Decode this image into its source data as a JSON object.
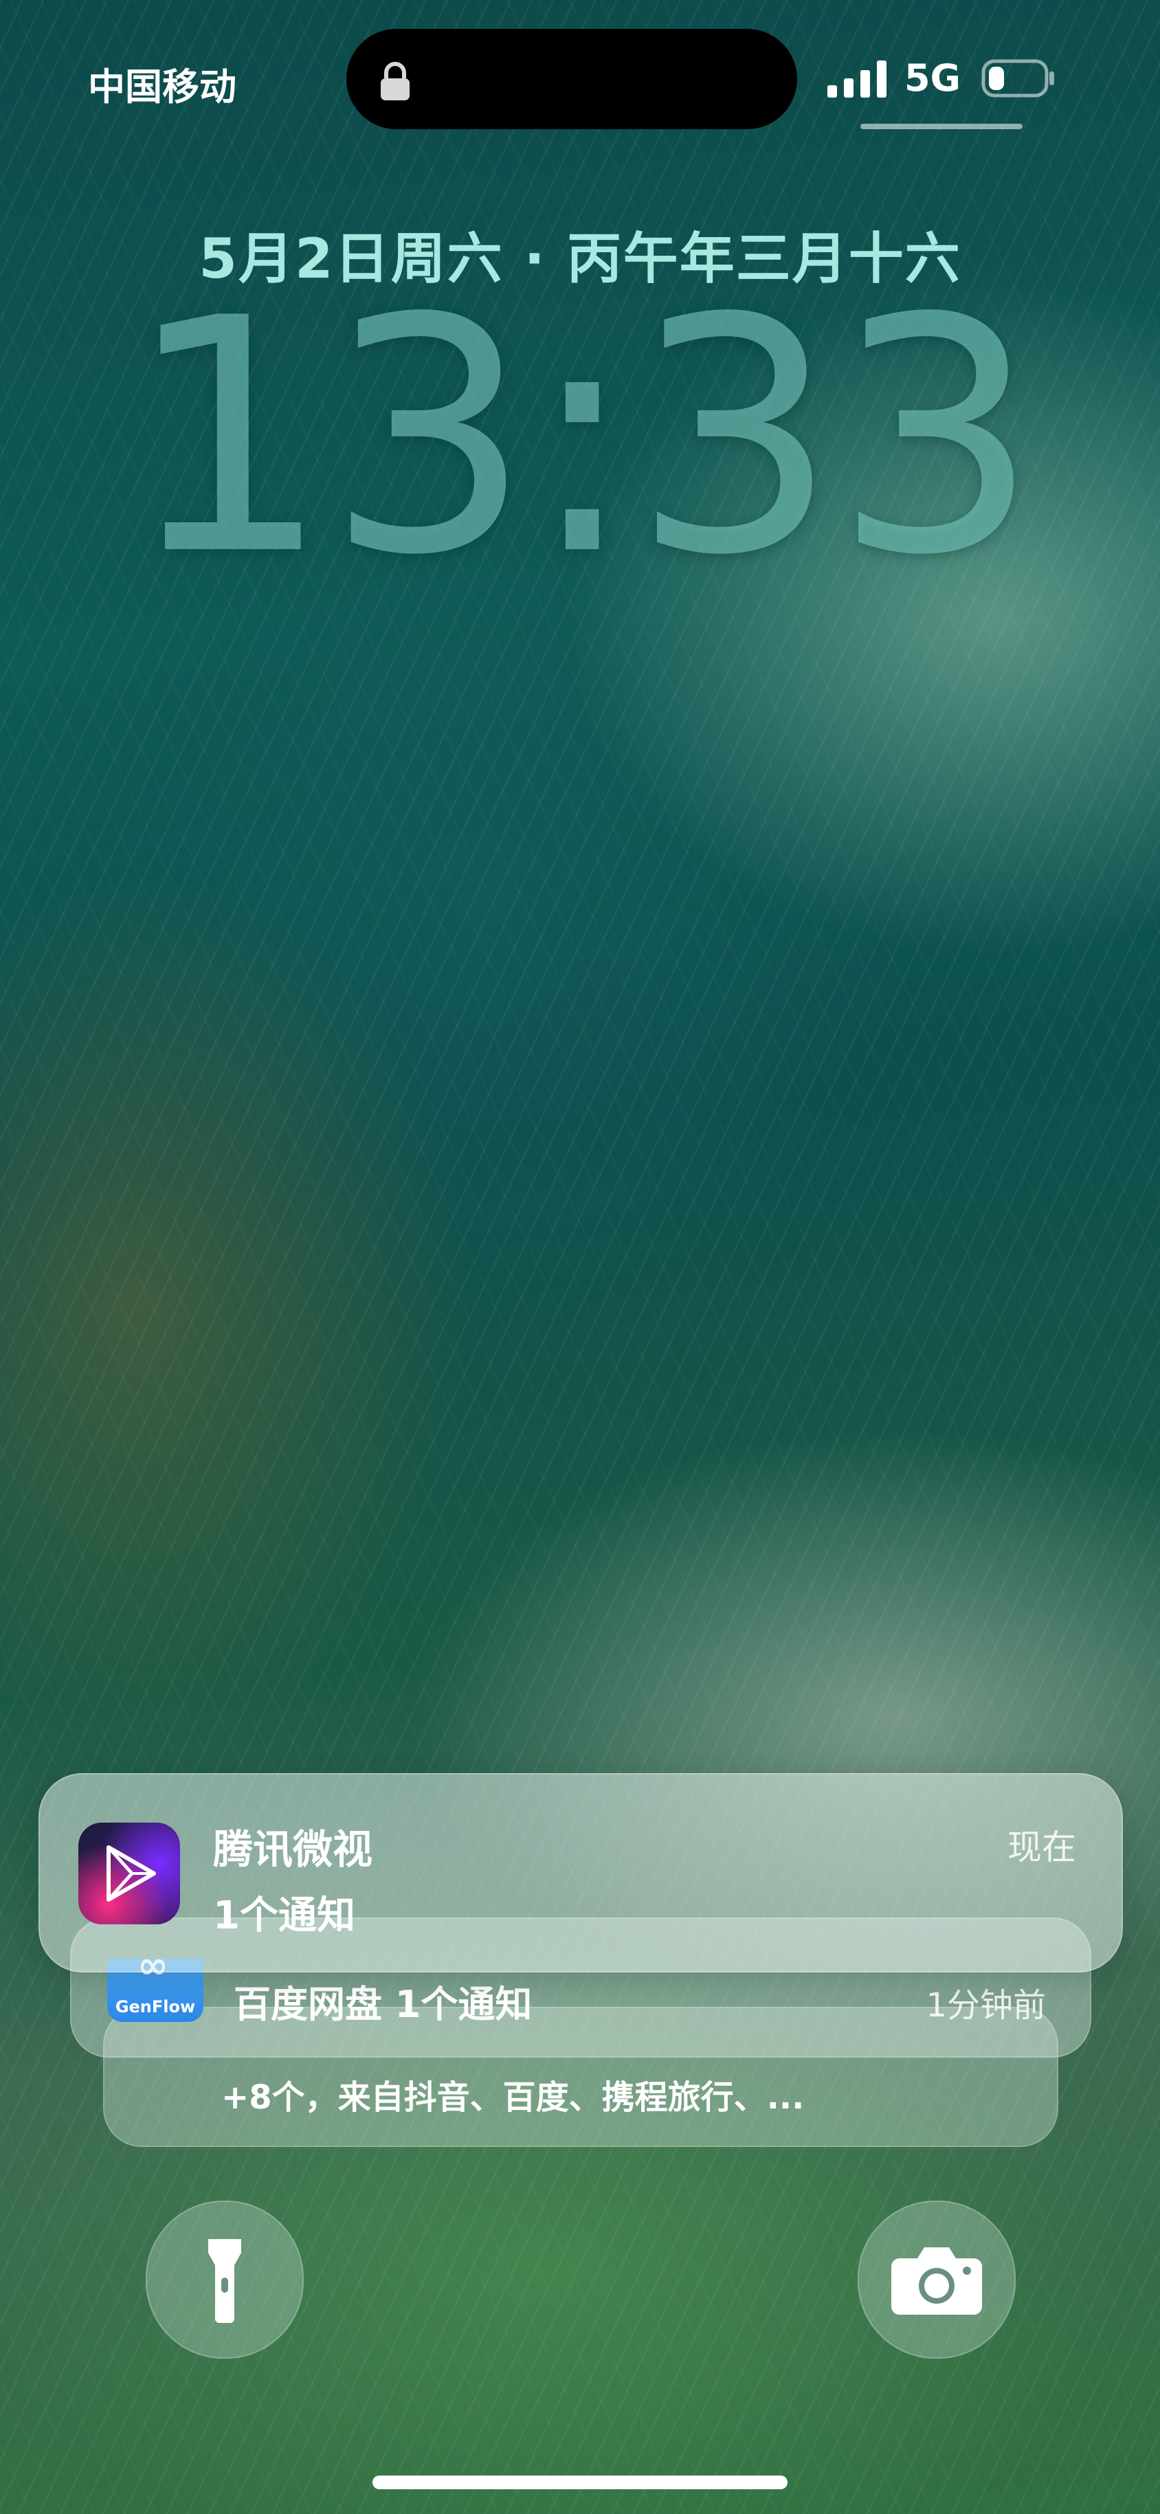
{
  "status_bar": {
    "carrier": "中国移动",
    "network": "5G",
    "icons": [
      "lock-icon",
      "cellular-signal-icon",
      "battery-icon"
    ]
  },
  "lock_screen": {
    "date": "5月2日周六 · 丙午年三月十六",
    "time": "13:33"
  },
  "notifications": {
    "primary": {
      "app": "腾讯微视",
      "body": "1个通知",
      "time": "现在",
      "icon": "weishi-app-icon"
    },
    "secondary": {
      "text": "百度网盘 1个通知",
      "time": "1分钟前",
      "icon": "baidu-netdisk-app-icon",
      "icon_text": "GenFlow"
    },
    "stack_more": "+8个，来自抖音、百度、携程旅行、..."
  },
  "controls": {
    "left": "flashlight-icon",
    "right": "camera-icon"
  },
  "colors": {
    "date_text": "#a8e8e0",
    "clock_text": "#78c8be",
    "notification_bg": "#e8f4ee"
  }
}
